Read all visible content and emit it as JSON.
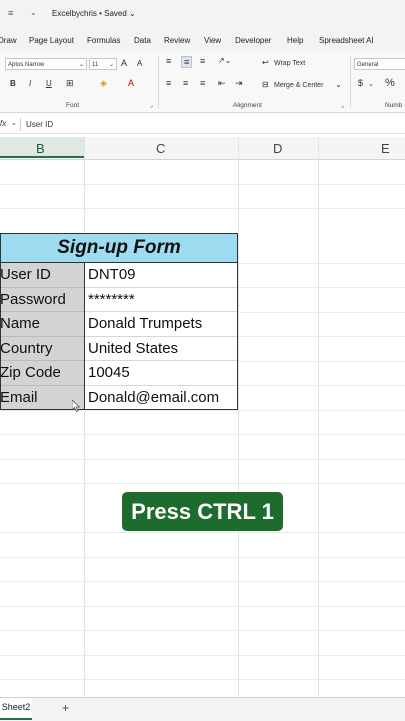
{
  "titlebar": {
    "quick_access": "≡",
    "doc_title": "Excelbychris • Saved ⌄"
  },
  "menu": [
    "Draw",
    "Page Layout",
    "Formulas",
    "Data",
    "Review",
    "View",
    "Developer",
    "Help",
    "Spreadsheet AI"
  ],
  "ribbon": {
    "font_name": "Aptos Narrow",
    "font_size": "11",
    "number_format": "General",
    "wrap_text": "Wrap Text",
    "merge_center": "Merge & Center",
    "group_font": "Font",
    "group_alignment": "Alignment",
    "group_number": "Numb",
    "bold": "B",
    "italic": "I",
    "underline": "U",
    "grow_font": "A",
    "shrink_font": "A",
    "currency": "$",
    "percent": "%"
  },
  "formula_bar": {
    "fx": "fx",
    "value": "User ID"
  },
  "columns": [
    "B",
    "C",
    "D",
    "E"
  ],
  "form": {
    "title": "Sign-up Form",
    "rows": [
      {
        "label": "User ID",
        "value": "DNT09"
      },
      {
        "label": "Password",
        "value": "********"
      },
      {
        "label": "Name",
        "value": "Donald Trumpets"
      },
      {
        "label": "Country",
        "value": "United States"
      },
      {
        "label": "Zip Code",
        "value": "10045"
      },
      {
        "label": "Email",
        "value": "Donald@email.com"
      }
    ]
  },
  "overlay": {
    "caption": "Press CTRL 1"
  },
  "sheets": {
    "active": "Sheet2",
    "add": "+"
  },
  "colors": {
    "header_fill": "#9ddcf0",
    "label_fill": "#d3d3d3",
    "caption_bg": "#1e6b2e",
    "accent": "#217346"
  }
}
